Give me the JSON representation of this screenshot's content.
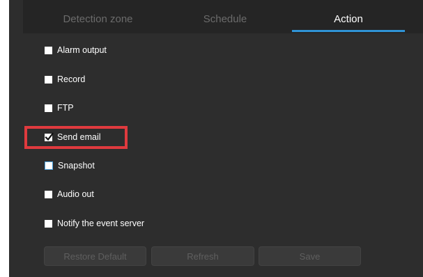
{
  "tabs": [
    {
      "label": "Detection zone",
      "active": false
    },
    {
      "label": "Schedule",
      "active": false
    },
    {
      "label": "Action",
      "active": true
    }
  ],
  "options": [
    {
      "label": "Alarm output",
      "checked": false
    },
    {
      "label": "Record",
      "checked": false
    },
    {
      "label": "FTP",
      "checked": false
    },
    {
      "label": "Send email",
      "checked": true,
      "highlighted": true
    },
    {
      "label": "Snapshot",
      "checked": false,
      "focused": true
    },
    {
      "label": "Audio out",
      "checked": false
    },
    {
      "label": "Notify the event server",
      "checked": false
    }
  ],
  "buttons": {
    "restore_default": "Restore Default",
    "refresh": "Refresh",
    "save": "Save"
  },
  "colors": {
    "panel_bg": "#2d2d2d",
    "tabbar_bg": "#252525",
    "accent": "#2f93d6",
    "highlight": "#e03a3e",
    "inactive_text": "#6b6b6b"
  }
}
